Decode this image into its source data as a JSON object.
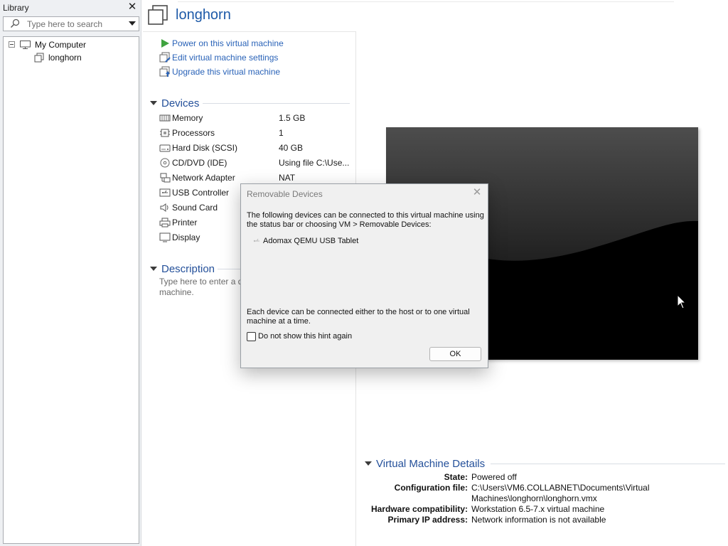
{
  "library": {
    "title": "Library",
    "close_glyph": "✕",
    "search_placeholder": "Type here to search",
    "search_icon": "search-icon",
    "dropdown_icon": "dropdown-arrow-icon",
    "tree": {
      "root": {
        "label": "My Computer",
        "icon": "computer-icon",
        "expanded": true
      },
      "children": [
        {
          "label": "longhorn",
          "icon": "vm-icon"
        }
      ]
    }
  },
  "vm": {
    "name": "longhorn",
    "icon": "vm-icon",
    "actions": [
      {
        "label": "Power on this virtual machine",
        "icon": "power-on-icon"
      },
      {
        "label": "Edit virtual machine settings",
        "icon": "edit-settings-icon"
      },
      {
        "label": "Upgrade this virtual machine",
        "icon": "upgrade-icon"
      }
    ]
  },
  "devices": {
    "heading": "Devices",
    "items": [
      {
        "name": "Memory",
        "value": "1.5 GB",
        "icon": "memory-icon"
      },
      {
        "name": "Processors",
        "value": "1",
        "icon": "processor-icon"
      },
      {
        "name": "Hard Disk (SCSI)",
        "value": "40 GB",
        "icon": "hard-disk-icon"
      },
      {
        "name": "CD/DVD (IDE)",
        "value": "Using file C:\\Use...",
        "icon": "cd-dvd-icon"
      },
      {
        "name": "Network Adapter",
        "value": "NAT",
        "icon": "network-adapter-icon"
      },
      {
        "name": "USB Controller",
        "value": "",
        "icon": "usb-controller-icon"
      },
      {
        "name": "Sound Card",
        "value": "",
        "icon": "sound-card-icon"
      },
      {
        "name": "Printer",
        "value": "",
        "icon": "printer-icon"
      },
      {
        "name": "Display",
        "value": "",
        "icon": "display-icon"
      }
    ]
  },
  "description": {
    "heading": "Description",
    "placeholder_line1": "Type here to enter a d",
    "placeholder_line2": "machine."
  },
  "details": {
    "heading": "Virtual Machine Details",
    "rows": [
      {
        "label": "State:",
        "value": "Powered off"
      },
      {
        "label": "Configuration file:",
        "value": "C:\\Users\\VM6.COLLABNET\\Documents\\Virtual Machines\\longhorn\\longhorn.vmx"
      },
      {
        "label": "Hardware compatibility:",
        "value": "Workstation 6.5-7.x virtual machine"
      },
      {
        "label": "Primary IP address:",
        "value": "Network information is not available"
      }
    ]
  },
  "dialog": {
    "title": "Removable Devices",
    "intro": "The following devices can be connected to this virtual machine using the status bar or choosing VM > Removable Devices:",
    "devices": [
      {
        "label": "Adomax QEMU USB Tablet",
        "icon": "usb-device-icon"
      }
    ],
    "note": "Each device can be connected either to the host or to one virtual machine at a time.",
    "checkbox_label": "Do not show this hint again",
    "checkbox_checked": false,
    "ok_label": "OK",
    "close_glyph": "✕"
  },
  "colors": {
    "accent": "#1e5aa8",
    "link": "#2a63b8",
    "power_green": "#3fa33f",
    "preview_bg": "#000000"
  }
}
